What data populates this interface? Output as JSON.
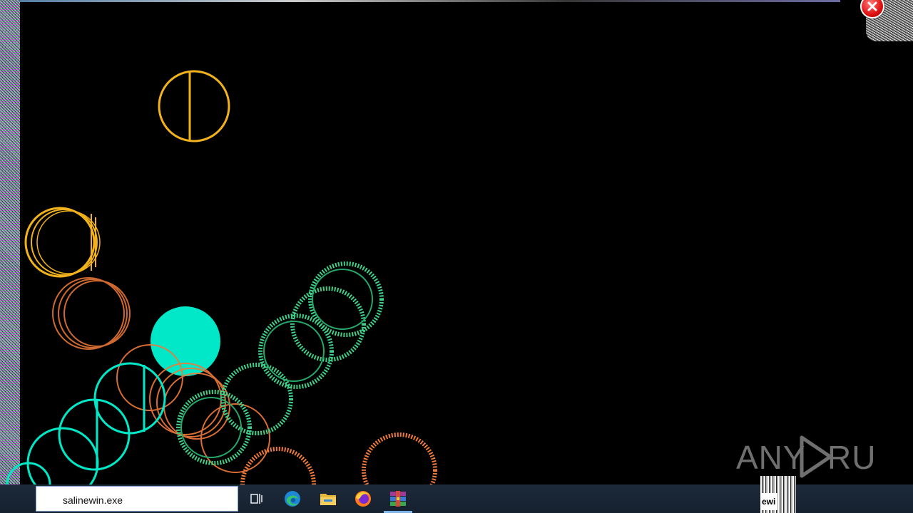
{
  "taskbar": {
    "search_value": "salinewin.exe",
    "icons": [
      "task-view-icon",
      "edge-icon",
      "file-explorer-icon",
      "firefox-icon",
      "winrar-icon"
    ],
    "active_app": "winrar-icon",
    "tray_fragment": "ewi"
  },
  "watermark": {
    "left": "ANY",
    "right": "RUN"
  },
  "colors": {
    "background": "#000000",
    "yellow": "#f2b21b",
    "orange": "#f07a3a",
    "teal": "#00e8c8",
    "green": "#3fd08a",
    "taskbar": "#1d2a3a"
  }
}
